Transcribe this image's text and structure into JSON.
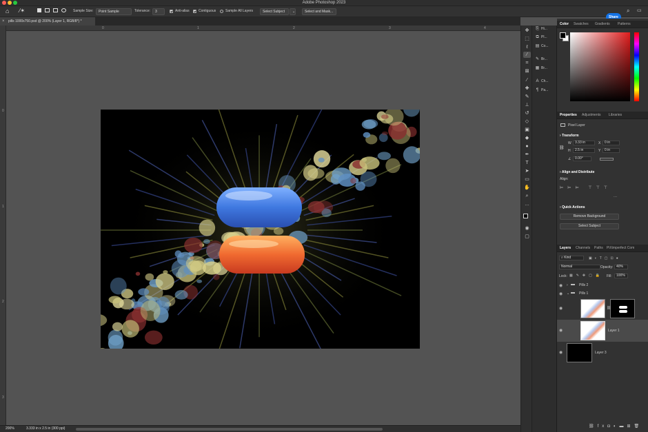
{
  "app": {
    "title": "Adobe Photoshop 2023",
    "share_label": "Share"
  },
  "options_bar": {
    "sample_size_label": "Sample Size:",
    "sample_size_value": "Point Sample",
    "tolerance_label": "Tolerance:",
    "tolerance_value": "3",
    "anti_alias_label": "Anti-alias",
    "contiguous_label": "Contiguous",
    "sample_all_label": "Sample All Layers",
    "select_subject_label": "Select Subject",
    "select_mask_label": "Select and Mask..."
  },
  "document": {
    "tab_title": "pills 1000x750.psd @ 200% (Layer 1, RGB/8*) *"
  },
  "rulers": {
    "h_ticks": [
      "0",
      "1",
      "2",
      "3",
      "4"
    ],
    "v_ticks": [
      "0",
      "1",
      "2",
      "3"
    ]
  },
  "status": {
    "zoom": "200%",
    "doc_info": "3.333 in x 2.5 in (300 ppi)"
  },
  "icon_panel": {
    "items": [
      "Hi...",
      "Pl...",
      "Co...",
      "Br...",
      "Br...",
      "Ch...",
      "Pa..."
    ]
  },
  "color_panel": {
    "tabs": [
      "Color",
      "Swatches",
      "Gradients",
      "Patterns"
    ]
  },
  "properties_panel": {
    "tabs": [
      "Properties",
      "Adjustments",
      "Libraries"
    ],
    "layer_type": "Pixel Layer",
    "transform_title": "Transform",
    "w_label": "W",
    "w_value": "3.33 in",
    "h_label": "H",
    "h_value": "2.5 in",
    "x_label": "X",
    "x_value": "0 in",
    "y_label": "Y",
    "y_value": "0 in",
    "angle_value": "0.00°",
    "align_title": "Align and Distribute",
    "align_label": "Align:",
    "quick_actions_title": "Quick Actions",
    "remove_bg_label": "Remove Background",
    "select_subject_label": "Select Subject"
  },
  "layers_panel": {
    "tabs": [
      "Layers",
      "Channels",
      "Paths",
      "PiXimperfect Com"
    ],
    "filter_value": "Kind",
    "blend_mode": "Normal",
    "opacity_label": "Opacity:",
    "opacity_value": "40%",
    "lock_label": "Lock:",
    "fill_label": "Fill:",
    "fill_value": "100%",
    "layers": [
      {
        "name": "Pills 2"
      },
      {
        "name": "Pills 1"
      },
      {
        "name": ""
      },
      {
        "name": "Layer 1"
      },
      {
        "name": "Layer 3"
      }
    ]
  },
  "colors": {
    "accent": "#1473e6",
    "panel": "#323232",
    "canvas_bg": "#000000"
  }
}
